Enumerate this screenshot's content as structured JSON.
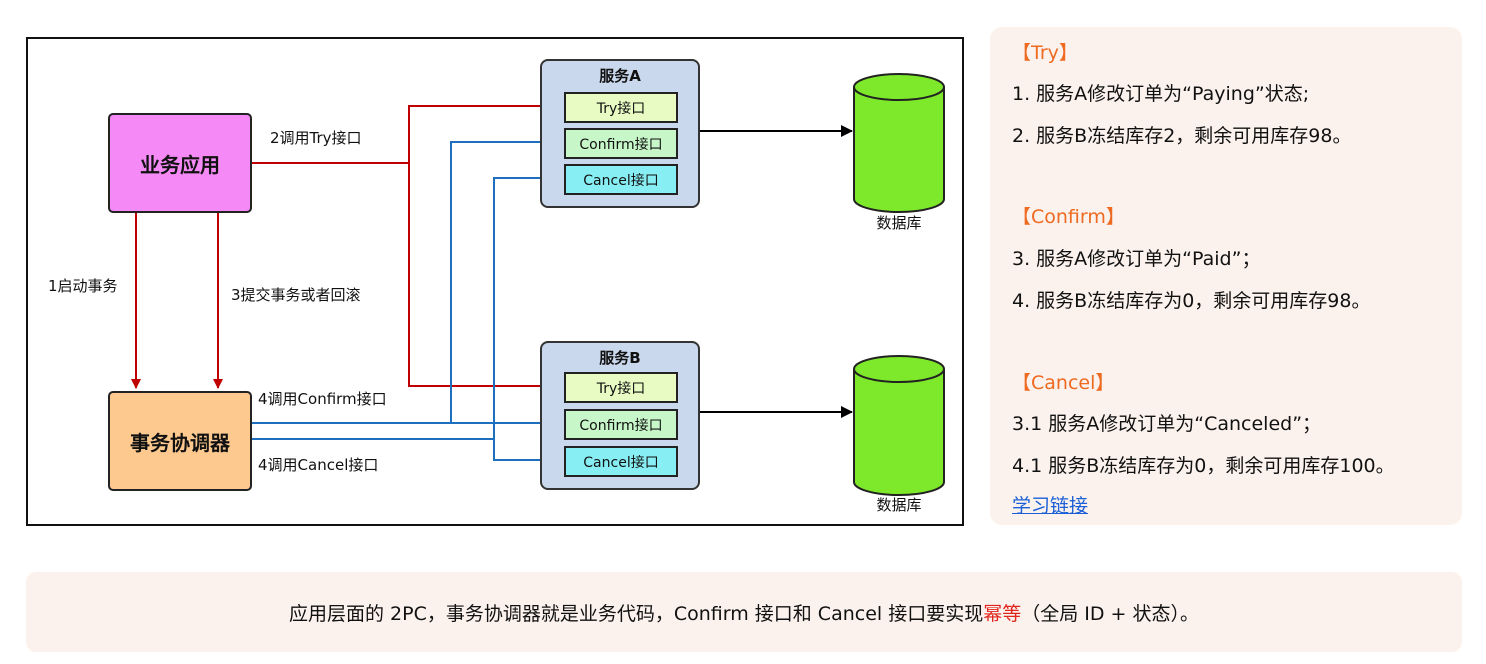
{
  "diagram": {
    "app_box": "业务应用",
    "coordinator_box": "事务协调器",
    "service_a": {
      "title": "服务A",
      "try": "Try接口",
      "confirm": "Confirm接口",
      "cancel": "Cancel接口"
    },
    "service_b": {
      "title": "服务B",
      "try": "Try接口",
      "confirm": "Confirm接口",
      "cancel": "Cancel接口"
    },
    "db_label_a": "数据库",
    "db_label_b": "数据库",
    "labels": {
      "call_try": "2调用Try接口",
      "start_tx": "1启动事务",
      "commit_or_rollback": "3提交事务或者回滚",
      "call_confirm": "4调用Confirm接口",
      "call_cancel": "4调用Cancel接口"
    },
    "colors": {
      "red_arrow": "#c00000",
      "blue_arrow": "#1f6fbf",
      "db": "#7ee82a"
    }
  },
  "notes": {
    "try_head": "【Try】",
    "try_1": "1.  服务A修改订单为“Paying”状态;",
    "try_2": "2.  服务B冻结库存2，剩余可用库存98。",
    "confirm_head": "【Confirm】",
    "confirm_1": "3. 服务A修改订单为“Paid”；",
    "confirm_2": "4. 服务B冻结库存为0，剩余可用库存98。",
    "cancel_head": "【Cancel】",
    "cancel_1": "3.1 服务A修改订单为“Canceled”；",
    "cancel_2": "4.1 服务B冻结库存为0，剩余可用库存100。",
    "link": "学习链接"
  },
  "footer": {
    "prefix": "应用层面的 2PC，事务协调器就是业务代码，Confirm 接口和 Cancel 接口要实现",
    "highlight": "幂等",
    "suffix": "（全局 ID + 状态）。"
  }
}
